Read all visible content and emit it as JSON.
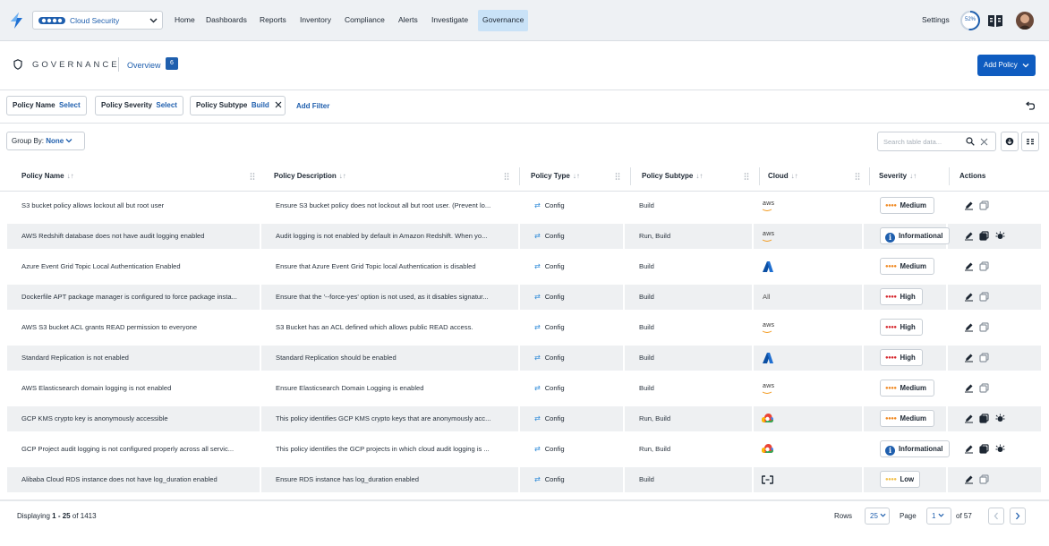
{
  "nav": {
    "tenant": "Cloud Security",
    "links": [
      "Home",
      "Dashboards",
      "Reports",
      "Inventory",
      "Compliance",
      "Alerts",
      "Investigate",
      "Governance"
    ],
    "active": "Governance",
    "settings": "Settings",
    "progress_label": "52%",
    "progress_value": 0.52
  },
  "header": {
    "title": "GOVERNANCE",
    "overview": "Overview",
    "overview_badge": "6",
    "add_policy": "Add Policy"
  },
  "filters": {
    "chips": [
      {
        "label": "Policy Name",
        "value": "Select"
      },
      {
        "label": "Policy Severity",
        "value": "Select"
      },
      {
        "label": "Policy Subtype",
        "value": "Build"
      }
    ],
    "add_filter": "Add Filter"
  },
  "toolbar": {
    "group_by_label": "Group By:",
    "group_by_value": "None",
    "search_placeholder": "Search table data..."
  },
  "table": {
    "columns": [
      "Policy Name",
      "Policy Description",
      "Policy Type",
      "Policy Subtype",
      "Cloud",
      "Severity",
      "Actions"
    ],
    "rows": [
      {
        "name": "S3 bucket policy allows lockout all but root user",
        "desc": "Ensure S3 bucket policy does not lockout all but root user. (Prevent lo...",
        "type": "Config",
        "subtype": "Build",
        "cloud": "aws",
        "severity": "Medium",
        "actions": 2
      },
      {
        "name": "AWS Redshift database does not have audit logging enabled",
        "desc": "Audit logging is not enabled by default in Amazon Redshift. When yo...",
        "type": "Config",
        "subtype": "Run, Build",
        "cloud": "aws",
        "severity": "Informational",
        "actions": 3
      },
      {
        "name": "Azure Event Grid Topic Local Authentication Enabled",
        "desc": "Ensure that Azure Event Grid Topic local Authentication is disabled",
        "type": "Config",
        "subtype": "Build",
        "cloud": "azure",
        "severity": "Medium",
        "actions": 2
      },
      {
        "name": "Dockerfile APT package manager is configured to force package insta...",
        "desc": "Ensure that the '--force-yes' option is not used, as it disables signatur...",
        "type": "Config",
        "subtype": "Build",
        "cloud": "All",
        "severity": "High",
        "actions": 2
      },
      {
        "name": "AWS S3 bucket ACL grants READ permission to everyone",
        "desc": "S3 Bucket has an ACL defined which allows public READ access.",
        "type": "Config",
        "subtype": "Build",
        "cloud": "aws",
        "severity": "High",
        "actions": 2
      },
      {
        "name": "Standard Replication is not enabled",
        "desc": "Standard Replication should be enabled",
        "type": "Config",
        "subtype": "Build",
        "cloud": "azure",
        "severity": "High",
        "actions": 2
      },
      {
        "name": "AWS Elasticsearch domain logging is not enabled",
        "desc": "Ensure Elasticsearch Domain Logging is enabled",
        "type": "Config",
        "subtype": "Build",
        "cloud": "aws",
        "severity": "Medium",
        "actions": 2
      },
      {
        "name": "GCP KMS crypto key is anonymously accessible",
        "desc": "This policy identifies GCP KMS crypto keys that are anonymously acc...",
        "type": "Config",
        "subtype": "Run, Build",
        "cloud": "gcp",
        "severity": "Medium",
        "actions": 3
      },
      {
        "name": "GCP Project audit logging is not configured properly across all servic...",
        "desc": "This policy identifies the GCP projects in which cloud audit logging is ...",
        "type": "Config",
        "subtype": "Run, Build",
        "cloud": "gcp",
        "severity": "Informational",
        "actions": 3
      },
      {
        "name": "Alibaba Cloud RDS instance does not have log_duration enabled",
        "desc": "Ensure RDS instance has log_duration enabled",
        "type": "Config",
        "subtype": "Build",
        "cloud": "alibaba",
        "severity": "Low",
        "actions": 2
      }
    ]
  },
  "footer": {
    "displaying_prefix": "Displaying",
    "displaying_range": "1 - 25",
    "displaying_suffix": "of 1413",
    "rows_label": "Rows",
    "rows_value": "25",
    "page_label": "Page",
    "page_value": "1",
    "of_pages": "of 57"
  },
  "colors": {
    "accent": "#0f5cc0",
    "medium": "#f08a24",
    "high": "#d6262d",
    "low": "#f2c14e",
    "info": "#1f5fae"
  }
}
